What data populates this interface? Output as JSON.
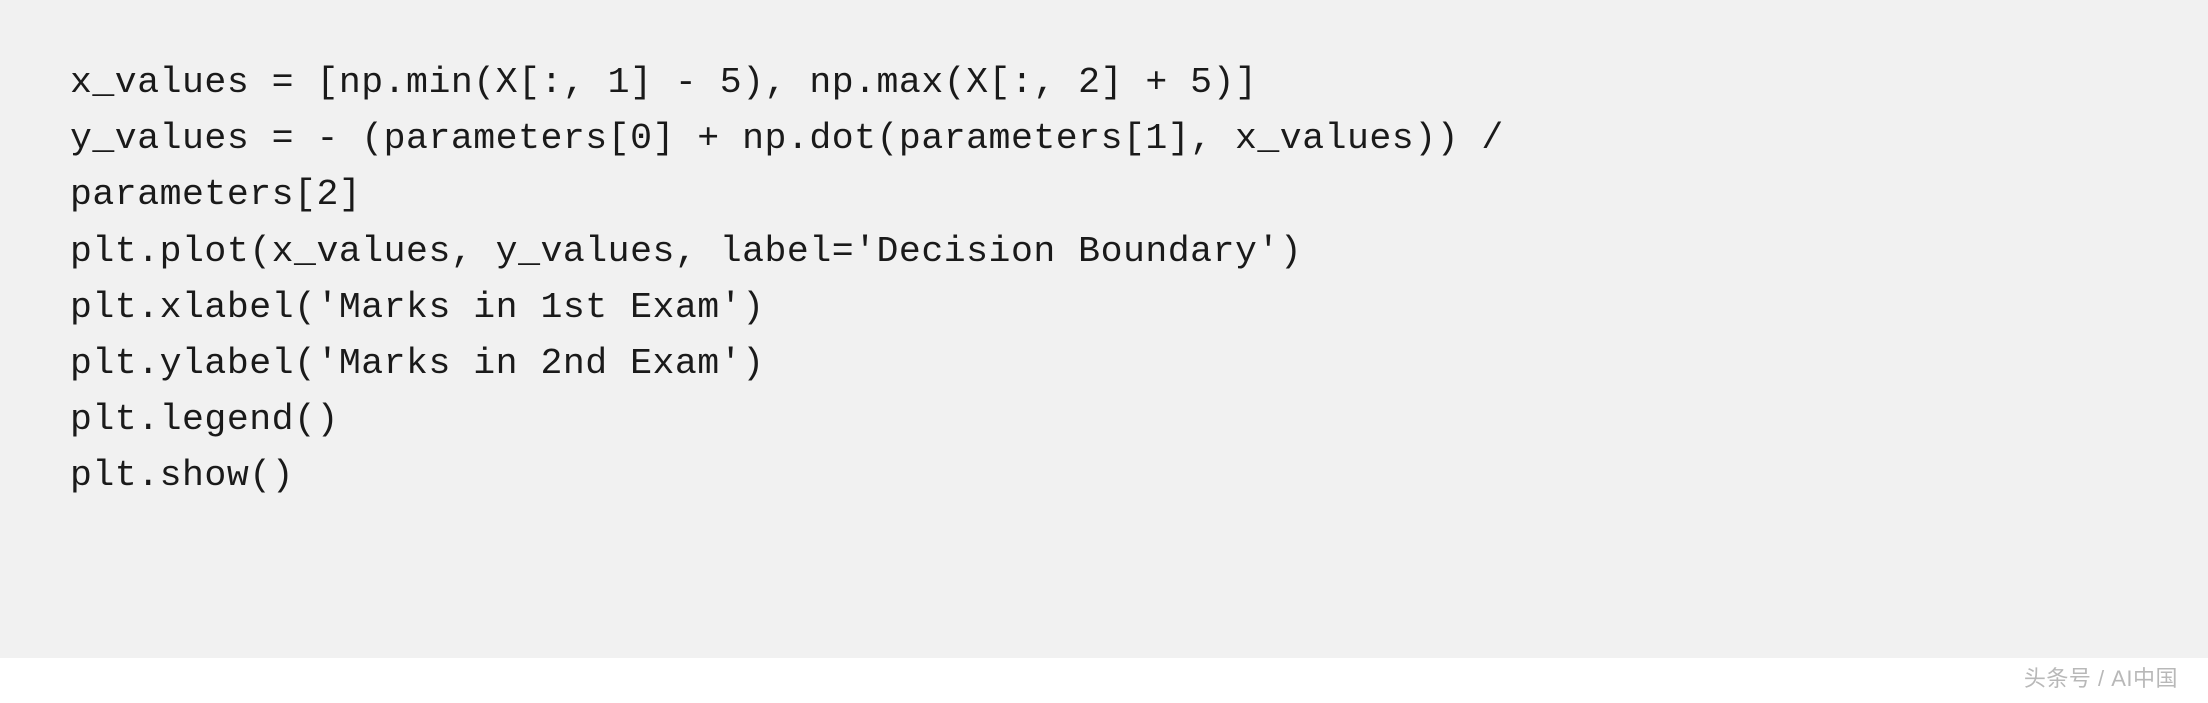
{
  "code": {
    "line1": "x_values = [np.min(X[:, 1] - 5), np.max(X[:, 2] + 5)]",
    "line2": "y_values = - (parameters[0] + np.dot(parameters[1], x_values)) / ",
    "line3": "parameters[2]",
    "line4": "",
    "line5": "plt.plot(x_values, y_values, label='Decision Boundary')",
    "line6": "plt.xlabel('Marks in 1st Exam')",
    "line7": "plt.ylabel('Marks in 2nd Exam')",
    "line8": "plt.legend()",
    "line9": "plt.show()"
  },
  "watermark": "头条号 / AI中国"
}
